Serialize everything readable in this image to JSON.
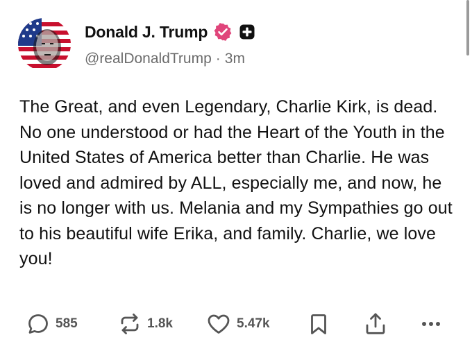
{
  "author": {
    "display_name": "Donald J. Trump",
    "handle": "@realDonaldTrump",
    "separator": "·",
    "time_ago": "3m",
    "avatar_icon": "american-flag-portrait-avatar",
    "verified_icon": "verified-badge-icon",
    "verified_color": "#e0457b",
    "plus_icon": "plus-badge-icon"
  },
  "post": {
    "text": "The Great, and even Legendary, Charlie Kirk, is dead. No one understood or had the Heart of the Youth in the United States of America better than Charlie. He was loved and admired by ALL, especially me, and now, he is no longer with us. Melania and my Sympathies go out to his beautiful wife Erika, and family. Charlie, we love you!"
  },
  "actions": {
    "replies": {
      "icon": "comment-bubble-icon",
      "count": "585"
    },
    "reposts": {
      "icon": "repost-arrows-icon",
      "count": "1.8k"
    },
    "likes": {
      "icon": "heart-icon",
      "count": "5.47k"
    },
    "bookmark": {
      "icon": "bookmark-icon"
    },
    "share": {
      "icon": "share-upload-icon"
    },
    "more": {
      "icon": "more-dots-icon"
    }
  },
  "colors": {
    "text": "#111111",
    "muted": "#6b6b6b",
    "icon": "#555555"
  }
}
